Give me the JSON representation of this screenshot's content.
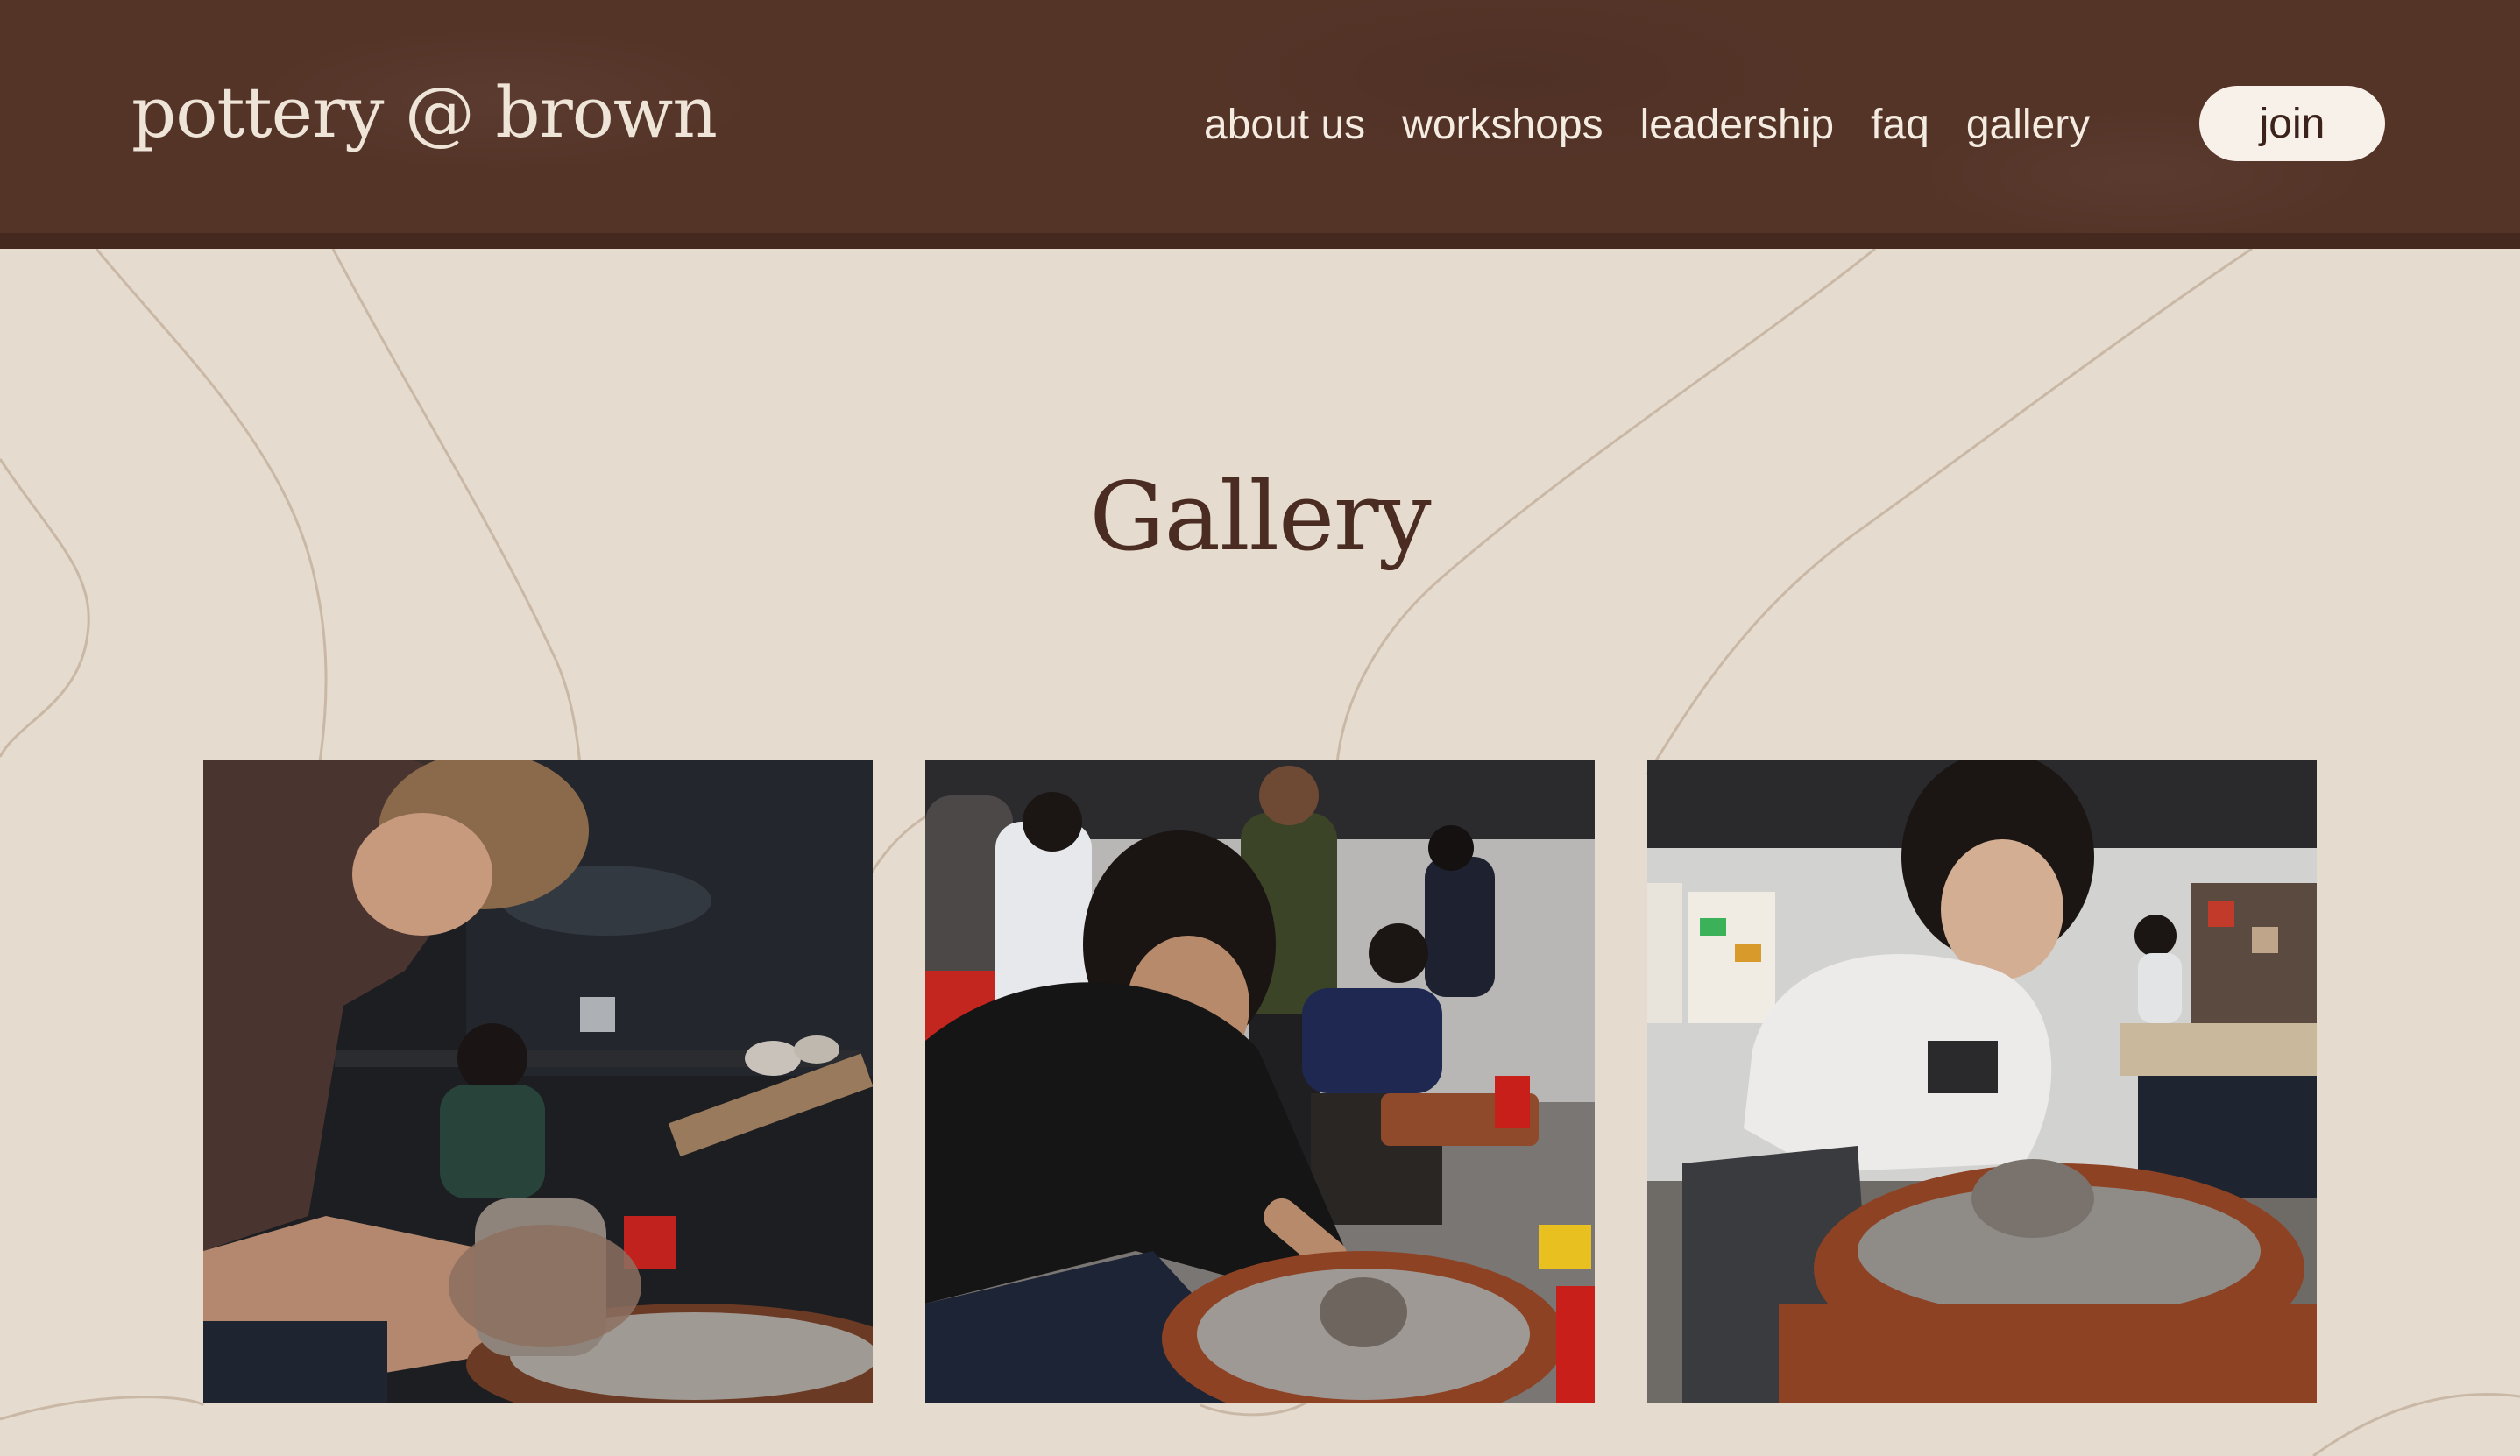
{
  "site": {
    "logo_text": "pottery @ brown"
  },
  "nav": {
    "items": [
      {
        "label": "about us"
      },
      {
        "label": "workshops"
      },
      {
        "label": "leadership"
      },
      {
        "label": "faq"
      },
      {
        "label": "gallery"
      }
    ],
    "join_label": "join"
  },
  "main": {
    "title": "Gallery",
    "photos": [
      {
        "subject": "student with glasses centering clay on a potter's wheel, studio behind"
      },
      {
        "subject": "student throwing a small pot on a wheel in a busy studio"
      },
      {
        "subject": "student in white hoodie centering clay on a wheel"
      }
    ]
  },
  "colors": {
    "header_bg": "#553428",
    "page_bg": "#e6dbcf",
    "title_color": "#4a2c22",
    "nav_text": "#f4ebe1",
    "join_bg": "#f8f1ea",
    "topo_line": "#c9b8a6"
  }
}
